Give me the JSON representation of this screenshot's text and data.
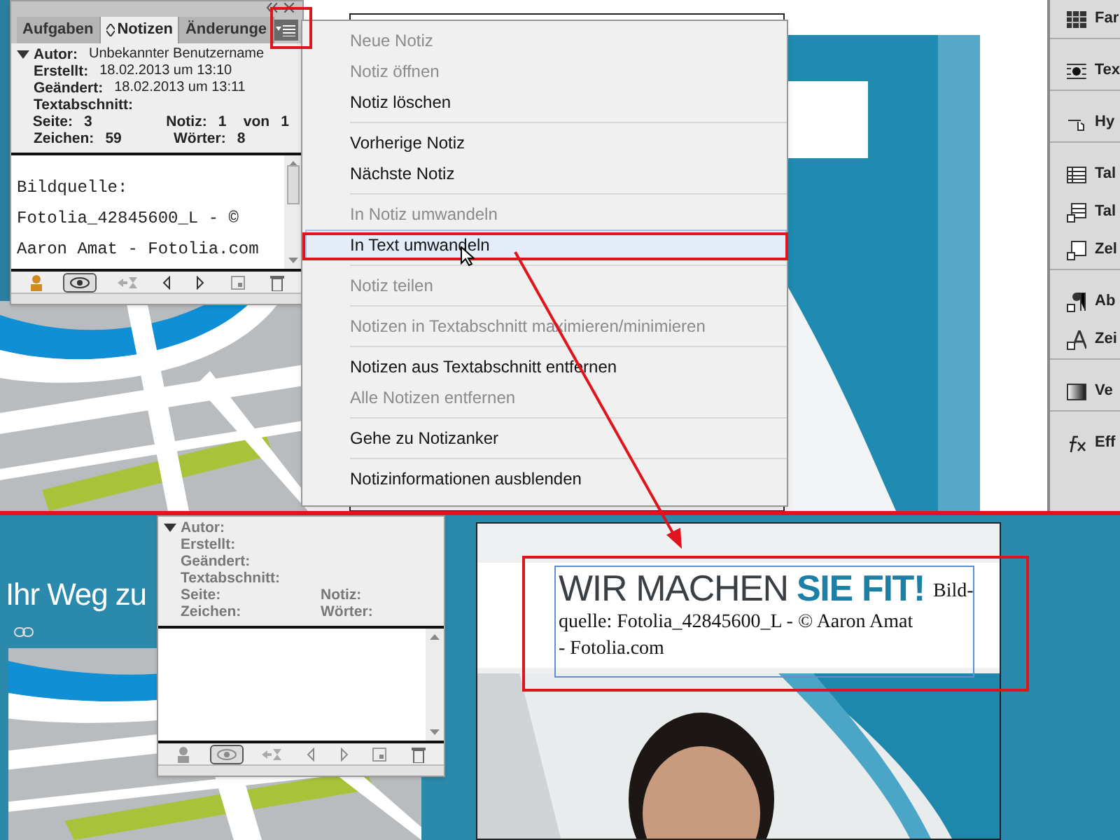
{
  "top": {
    "notes_panel": {
      "disabled": false,
      "tabs": [
        {
          "label": "Aufgaben",
          "selected": false
        },
        {
          "label": "Notizen",
          "selected": true
        },
        {
          "label": "Änderunge",
          "selected": false
        }
      ],
      "rows": [
        [
          {
            "label": "Autor:",
            "value": "Unbekannter Benutzername"
          }
        ],
        [
          {
            "label": "Erstellt:",
            "value": "18.02.2013 um 13:10"
          }
        ],
        [
          {
            "label": "Geändert:",
            "value": "18.02.2013 um 13:11"
          }
        ],
        [
          {
            "label": "Textabschnitt:"
          }
        ],
        [
          {
            "label": "Seite:",
            "value": "3"
          },
          {
            "label": "Notiz:",
            "value": "1"
          },
          {
            "label": "von",
            "value": "1"
          }
        ],
        [
          {
            "label": "Zeichen:",
            "value": "59"
          },
          {
            "label": "Wörter:",
            "value": "8"
          }
        ]
      ],
      "note_lines": [
        "Bildquelle:",
        "Fotolia_42845600_L - ©",
        "Aaron Amat - Fotolia.com"
      ],
      "tools": [
        {
          "kind": "author",
          "selected": false
        },
        {
          "kind": "eye",
          "selected": true
        },
        {
          "kind": "convert",
          "selected": false
        },
        {
          "kind": "previous",
          "selected": false
        },
        {
          "kind": "next",
          "selected": false
        },
        {
          "kind": "new",
          "selected": false
        },
        {
          "kind": "delete",
          "selected": false
        }
      ]
    },
    "menu": {
      "groups": [
        [
          {
            "label": "Neue Notiz",
            "disabled": true,
            "selected": false
          },
          {
            "label": "Notiz öffnen",
            "disabled": true,
            "selected": false
          },
          {
            "label": "Notiz löschen",
            "disabled": false,
            "selected": false
          }
        ],
        [
          {
            "label": "Vorherige Notiz",
            "disabled": false,
            "selected": false
          },
          {
            "label": "Nächste Notiz",
            "disabled": false,
            "selected": false
          }
        ],
        [
          {
            "label": "In Notiz umwandeln",
            "disabled": true,
            "selected": false
          },
          {
            "label": "In Text umwandeln",
            "disabled": false,
            "selected": true
          }
        ],
        [
          {
            "label": "Notiz teilen",
            "disabled": true,
            "selected": false
          }
        ],
        [
          {
            "label": "Notizen in Textabschnitt maximieren/minimieren",
            "disabled": true,
            "selected": false
          }
        ],
        [
          {
            "label": "Notizen aus Textabschnitt entfernen",
            "disabled": false,
            "selected": false
          },
          {
            "label": "Alle Notizen entfernen",
            "disabled": true,
            "selected": false
          }
        ],
        [
          {
            "label": "Gehe zu Notizanker",
            "disabled": false,
            "selected": false
          }
        ],
        [
          {
            "label": "Notizinformationen ausblenden",
            "disabled": false,
            "selected": false
          }
        ]
      ]
    },
    "side_panel": {
      "groups": [
        [
          {
            "kind": "swatches",
            "label": "Far"
          }
        ],
        [
          {
            "kind": "text-wrap",
            "label": "Tex"
          }
        ],
        [
          {
            "kind": "hyperlink",
            "label": "Hy"
          }
        ],
        [
          {
            "kind": "table",
            "label": "Tal"
          },
          {
            "kind": "table-style",
            "label": "Tal"
          },
          {
            "kind": "cell-style",
            "label": "Zel"
          }
        ],
        [
          {
            "kind": "paragraph-style",
            "label": "Ab"
          },
          {
            "kind": "character-style",
            "label": "Zei"
          }
        ],
        [
          {
            "kind": "gradient",
            "label": "Ve"
          }
        ],
        [
          {
            "kind": "effects",
            "label": "Eff"
          }
        ]
      ]
    }
  },
  "bottom": {
    "page_heading": "Ihr Weg zu",
    "notes_panel": {
      "disabled": true,
      "rows": [
        [
          {
            "label": "Autor:"
          }
        ],
        [
          {
            "label": "Erstellt:"
          }
        ],
        [
          {
            "label": "Geändert:"
          }
        ],
        [
          {
            "label": "Textabschnitt:"
          }
        ],
        [
          {
            "label": "Seite:"
          },
          {
            "label": "Notiz:"
          }
        ],
        [
          {
            "label": "Zeichen:"
          },
          {
            "label": "Wörter:"
          }
        ]
      ],
      "tools": [
        {
          "kind": "author",
          "selected": false
        },
        {
          "kind": "eye",
          "selected": true
        },
        {
          "kind": "convert",
          "selected": false
        },
        {
          "kind": "previous",
          "selected": false
        },
        {
          "kind": "next",
          "selected": false
        },
        {
          "kind": "new",
          "selected": false
        },
        {
          "kind": "delete",
          "selected": false
        }
      ]
    },
    "headline": "WIR MACHEN",
    "headline_accent": "SIE FIT!",
    "caption_lines": [
      "Bild-",
      "quelle: Fotolia_42845600_L - © Aaron Amat",
      "- Fotolia.com"
    ]
  }
}
